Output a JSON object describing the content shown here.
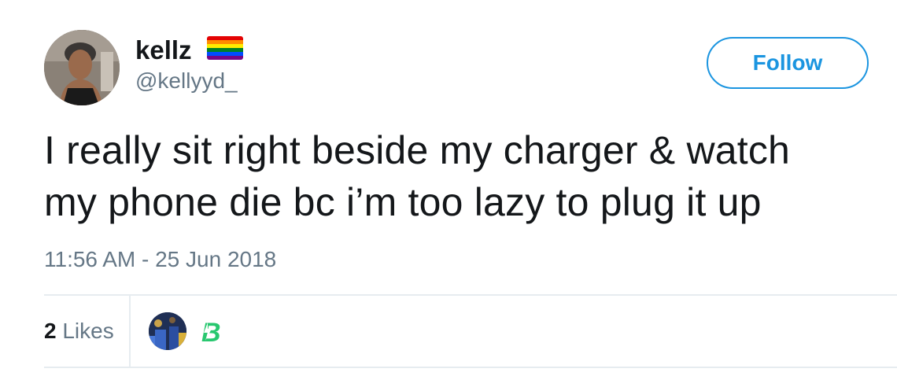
{
  "author": {
    "display_name": "kellz",
    "handle": "@kellyyd_",
    "avatar_icon": "profile-photo",
    "badge_icon": "rainbow-flag-emoji"
  },
  "actions": {
    "follow_label": "Follow"
  },
  "tweet": {
    "text_line_1": "I really sit right beside my charger & watch",
    "text_line_2": "my phone die bc i’m too lazy to plug it up",
    "timestamp": "11:56 AM - 25 Jun 2018"
  },
  "stats": {
    "likes_count": "2",
    "likes_label": "Likes"
  },
  "likers": [
    {
      "icon": "liker-avatar-photo"
    },
    {
      "icon": "liker-avatar-logo",
      "logo_text": "B"
    }
  ],
  "colors": {
    "accent": "#1b95e0",
    "secondary_text": "#657786",
    "primary_text": "#14171a",
    "divider": "#e6ecf0",
    "liker_logo": "#28c76f"
  }
}
